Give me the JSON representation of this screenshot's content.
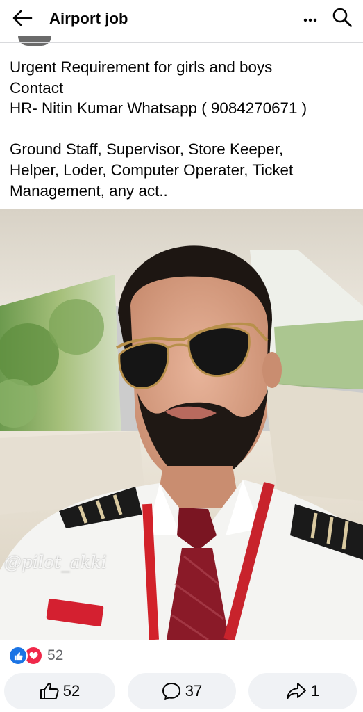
{
  "header": {
    "title": "Airport job",
    "back_icon": "arrow-left-icon",
    "more_icon": "more-horizontal-icon",
    "search_icon": "search-icon"
  },
  "post": {
    "lines": [
      "Urgent Requirement for girls and boys",
      "Contact",
      "HR- Nitin Kumar Whatsapp ( 9084270671 )"
    ],
    "lines2": [
      "Ground Staff, Supervisor, Store Keeper,",
      "Helper, Loder, Computer Operater, Ticket",
      "Management, any act.."
    ],
    "image_watermark": "@pilot_akki"
  },
  "reactions": {
    "count": "52",
    "types": [
      "like",
      "love"
    ],
    "colors": {
      "like": "#1b74e4",
      "love": "#f0284a"
    }
  },
  "actions": {
    "like_count": "52",
    "comment_count": "37",
    "share_count": "1"
  }
}
